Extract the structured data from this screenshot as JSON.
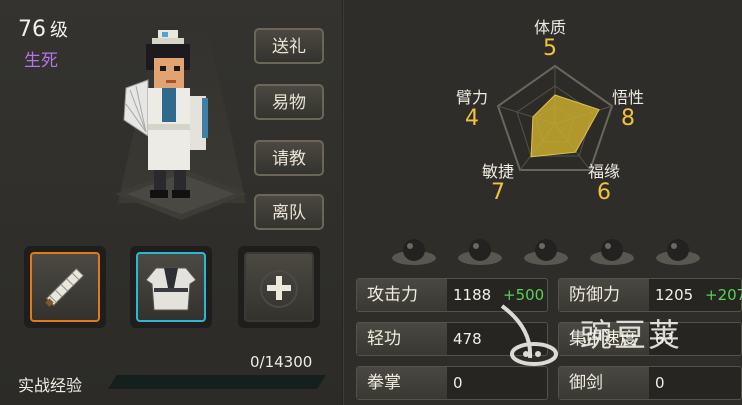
{
  "character": {
    "level": "76",
    "level_unit": "级",
    "title": "生死"
  },
  "actions": [
    {
      "label": "送礼"
    },
    {
      "label": "易物"
    },
    {
      "label": "请教"
    },
    {
      "label": "离队"
    }
  ],
  "equipment": [
    {
      "name": "fan-icon",
      "border": "#e07a1a"
    },
    {
      "name": "robe-icon",
      "border": "#2ab8d6"
    },
    {
      "name": "add-icon",
      "border": "#3a3935"
    }
  ],
  "experience": {
    "progress": "0/14300",
    "current": 0,
    "max": 14300,
    "label": "实战经验"
  },
  "attributes": {
    "top": {
      "label": "体质",
      "value": "5"
    },
    "right": {
      "label": "悟性",
      "value": "8"
    },
    "bottom_right": {
      "label": "福缘",
      "value": "6"
    },
    "bottom_left": {
      "label": "敏捷",
      "value": "7"
    },
    "left": {
      "label": "臂力",
      "value": "4"
    }
  },
  "stats": [
    {
      "label": "攻击力",
      "value": "1188",
      "bonus": "+500"
    },
    {
      "label": "防御力",
      "value": "1205",
      "bonus": "+207"
    },
    {
      "label": "轻功",
      "value": "478",
      "bonus": ""
    },
    {
      "label": "集中速度",
      "value": "63",
      "bonus": ""
    },
    {
      "label": "拳掌",
      "value": "0",
      "bonus": ""
    },
    {
      "label": "御剑",
      "value": "0",
      "bonus": ""
    }
  ],
  "watermark": {
    "text": "豌豆荚"
  },
  "colors": {
    "accent_gold": "#f2c23c",
    "title_purple": "#b276e6",
    "bonus_green": "#55d456",
    "slot_orange": "#e07a1a",
    "slot_cyan": "#2ab8d6"
  }
}
